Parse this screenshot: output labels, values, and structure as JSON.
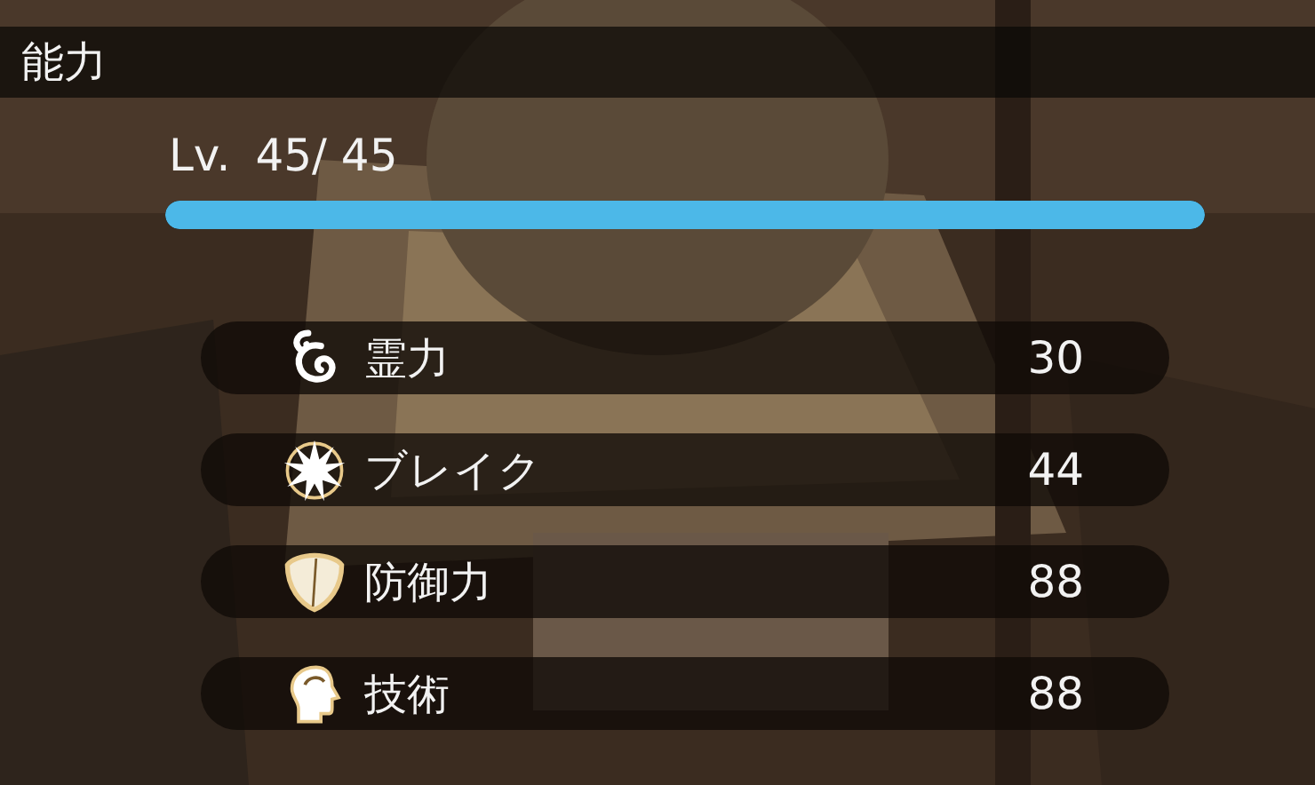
{
  "header": {
    "title": "能力"
  },
  "level": {
    "label": "Lv.",
    "value": "45/ 45",
    "level": 1.0
  },
  "stats": [
    {
      "kind": "spirit",
      "label": "霊力",
      "value": "30"
    },
    {
      "kind": "break",
      "label": "ブレイク",
      "value": "44"
    },
    {
      "kind": "defense",
      "label": "防御力",
      "value": "88"
    },
    {
      "kind": "skill",
      "label": "技術",
      "value": "88"
    }
  ]
}
